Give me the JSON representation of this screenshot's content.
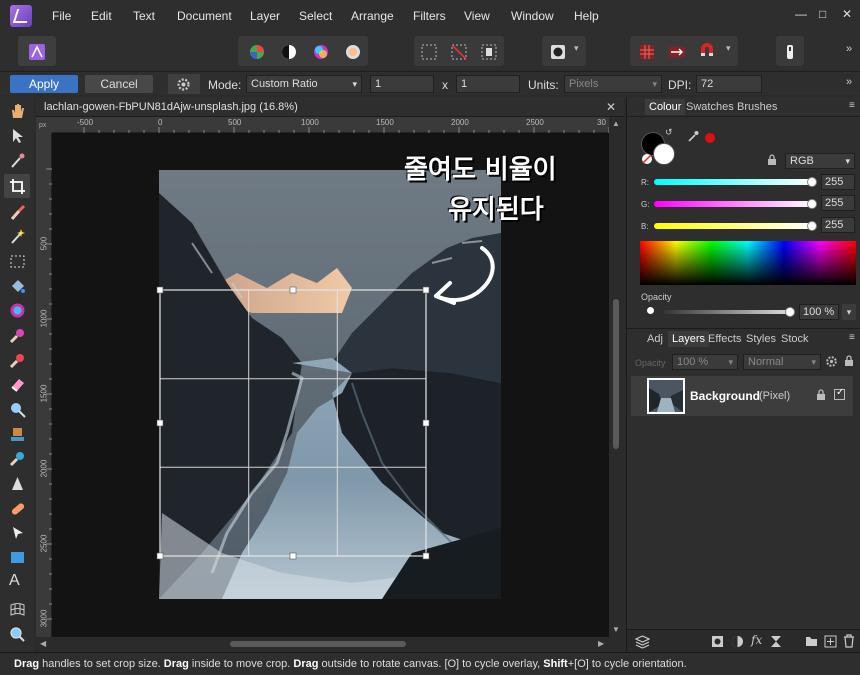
{
  "menu": [
    "File",
    "Edit",
    "Text",
    "Document",
    "Layer",
    "Select",
    "Arrange",
    "Filters",
    "View",
    "Window",
    "Help"
  ],
  "context": {
    "apply": "Apply",
    "cancel": "Cancel",
    "mode_label": "Mode:",
    "mode_value": "Custom Ratio",
    "ratio_w": "1",
    "ratio_x": "x",
    "ratio_h": "1",
    "units_label": "Units:",
    "units_value": "Pixels",
    "dpi_label": "DPI:",
    "dpi_value": "72"
  },
  "document": {
    "tab_title": "lachlan-gowen-FbPUN81dAjw-unsplash.jpg (16.8%)",
    "ruler_unit": "px",
    "ruler_top": [
      "-500",
      "0",
      "500",
      "1000",
      "1500",
      "2000",
      "2500",
      "30"
    ],
    "ruler_left": [
      "500",
      "1000",
      "1500",
      "2000",
      "2500",
      "3000"
    ],
    "annotation_line1": "줄여도 비율이",
    "annotation_line2": "유지된다"
  },
  "colour_panel": {
    "tabs": [
      "Colour",
      "Swatches",
      "Brushes"
    ],
    "model": "RGB",
    "r_label": "R:",
    "r_value": "255",
    "g_label": "G:",
    "g_value": "255",
    "b_label": "B:",
    "b_value": "255",
    "opacity_label": "Opacity",
    "opacity_value": "100 %"
  },
  "layers_panel": {
    "tabs": [
      "Adj",
      "Layers",
      "Effects",
      "Styles",
      "Stock"
    ],
    "opacity_label": "Opacity",
    "opacity_value": "100 %",
    "blend_mode": "Normal",
    "layer_name": "Background",
    "layer_type": "(Pixel)"
  },
  "status": {
    "w1": "Drag",
    "t1": " handles to set crop size. ",
    "w2": "Drag",
    "t2": " inside to move crop. ",
    "w3": "Drag",
    "t3": " outside to rotate canvas. [O] to cycle overlay, ",
    "w4": "Shift",
    "t4": "+[O] to cycle orientation."
  },
  "colors": {
    "accent": "#3b73c4",
    "primary_fg": "#000000",
    "secondary_fg": "#ffffff",
    "record": "#e01010"
  }
}
